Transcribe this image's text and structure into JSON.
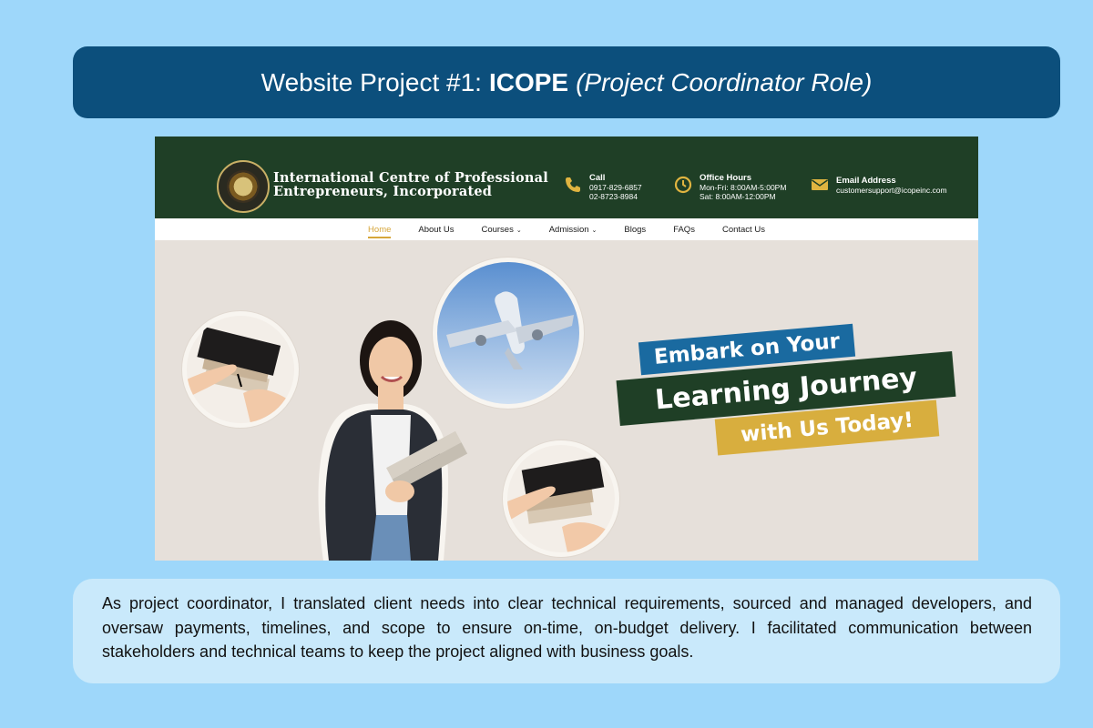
{
  "header": {
    "title_prefix": "Website Project #1:",
    "title_bold": "ICOPE",
    "title_italic": "(Project Coordinator Role)"
  },
  "site": {
    "org_line1": "International Centre of Professional",
    "org_line2": "Entrepreneurs, Incorporated",
    "call": {
      "heading": "Call",
      "line1": "0917-829-6857",
      "line2": "02-8723-8984"
    },
    "hours": {
      "heading": "Office Hours",
      "line1": "Mon-Fri: 8:00AM-5:00PM",
      "line2": "Sat: 8:00AM-12:00PM"
    },
    "email": {
      "heading": "Email Address",
      "line1": "customersupport@icopeinc.com"
    },
    "nav": {
      "home": "Home",
      "about": "About Us",
      "courses": "Courses",
      "admission": "Admission",
      "blogs": "Blogs",
      "faqs": "FAQs",
      "contact": "Contact Us",
      "caret": "⌄"
    },
    "hero": {
      "line1": "Embark on Your",
      "line2": "Learning Journey",
      "line3": "with Us Today!"
    }
  },
  "description": "As project coordinator, I translated client needs into clear technical requirements, sourced and managed developers, and oversaw payments, timelines, and scope to ensure on-time, on-budget delivery. I facilitated communication between stakeholders and technical teams to keep the project aligned with business goals.",
  "colors": {
    "page_bg": "#9ed7fa",
    "title_bar": "#0c4f7c",
    "site_header": "#1f3f26",
    "nav_active": "#d6a63a",
    "banner_blue": "#1a6aa0",
    "banner_green": "#1f3f26",
    "banner_gold": "#d8ae3e"
  }
}
